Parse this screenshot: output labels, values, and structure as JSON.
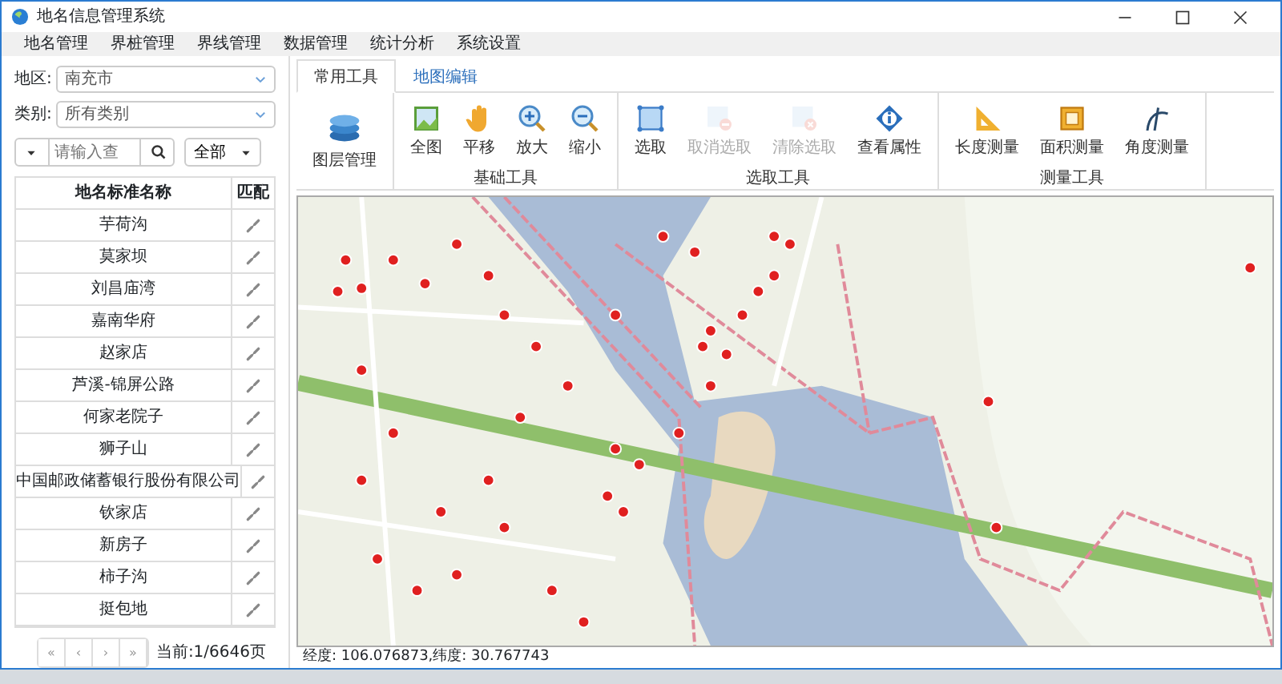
{
  "window": {
    "title": "地名信息管理系统"
  },
  "menu": [
    "地名管理",
    "界桩管理",
    "界线管理",
    "数据管理",
    "统计分析",
    "系统设置"
  ],
  "filters": [
    {
      "label": "地区:",
      "value": "南充市"
    },
    {
      "label": "类别:",
      "value": "所有类别"
    }
  ],
  "search": {
    "placeholder": "请输入查",
    "scope": "全部"
  },
  "table": {
    "columns": [
      "地名标准名称",
      "匹配"
    ],
    "rows": [
      {
        "name": "芋荷沟"
      },
      {
        "name": "莫家坝"
      },
      {
        "name": "刘昌庙湾"
      },
      {
        "name": "嘉南华府"
      },
      {
        "name": "赵家店"
      },
      {
        "name": "芦溪-锦屏公路"
      },
      {
        "name": "何家老院子"
      },
      {
        "name": "狮子山"
      },
      {
        "name": "中国邮政储蓄银行股份有限公司"
      },
      {
        "name": "钦家店"
      },
      {
        "name": "新房子"
      },
      {
        "name": "柿子沟"
      },
      {
        "name": "挺包地"
      }
    ]
  },
  "pager": {
    "buttons": [
      "«",
      "‹",
      "›",
      "»"
    ],
    "info": "当前:1/6646页"
  },
  "tabs": [
    {
      "label": "常用工具",
      "selected": true
    },
    {
      "label": "地图编辑",
      "selected": false
    }
  ],
  "toolbar": {
    "layer_button": "图层管理",
    "groups": [
      {
        "label": "基础工具",
        "tools": [
          {
            "label": "全图",
            "disabled": false
          },
          {
            "label": "平移",
            "disabled": false
          },
          {
            "label": "放大",
            "disabled": false
          },
          {
            "label": "缩小",
            "disabled": false
          }
        ]
      },
      {
        "label": "选取工具",
        "tools": [
          {
            "label": "选取",
            "disabled": false
          },
          {
            "label": "取消选取",
            "disabled": true
          },
          {
            "label": "清除选取",
            "disabled": true
          },
          {
            "label": "查看属性",
            "disabled": false
          }
        ]
      },
      {
        "label": "测量工具",
        "tools": [
          {
            "label": "长度测量",
            "disabled": false
          },
          {
            "label": "面积测量",
            "disabled": false
          },
          {
            "label": "角度测量",
            "disabled": false
          }
        ]
      }
    ]
  },
  "status_bar": {
    "coordinates": "经度: 106.076873,纬度: 30.767743"
  }
}
